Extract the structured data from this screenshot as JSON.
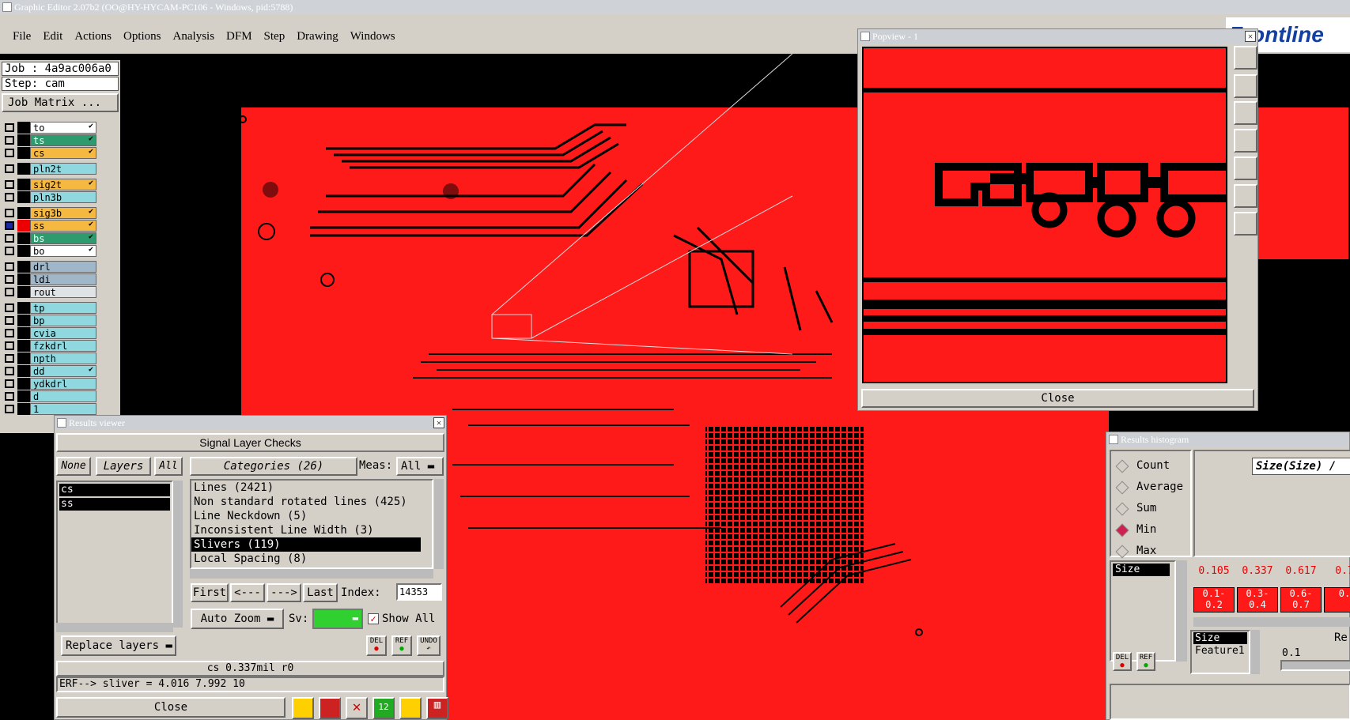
{
  "app": {
    "title": "Graphic Editor 2.07b2 (OO@HY-HYCAM-PC106 - Windows, pid:5788)",
    "brand": "Frontline"
  },
  "menu": [
    "File",
    "Edit",
    "Actions",
    "Options",
    "Analysis",
    "DFM",
    "Step",
    "Drawing",
    "Windows"
  ],
  "job": {
    "job_label": "Job : 4a9ac006a0",
    "step_label": "Step: cam",
    "matrix_button": "Job Matrix ..."
  },
  "layers": [
    {
      "name": "to",
      "color": "#ffffff",
      "tick": true
    },
    {
      "name": "ts",
      "color": "#2e9b6e",
      "tick": true
    },
    {
      "name": "cs",
      "color": "#f5b942",
      "tick": true
    },
    {
      "name": "pln2t",
      "color": "#8fd8e0",
      "tick": false
    },
    {
      "name": "sig2t",
      "color": "#f5b942",
      "tick": true
    },
    {
      "name": "pln3b",
      "color": "#8fd8e0",
      "tick": false
    },
    {
      "name": "sig3b",
      "color": "#f5b942",
      "tick": true
    },
    {
      "name": "ss",
      "color": "#f5b942",
      "tick": true,
      "active": true
    },
    {
      "name": "bs",
      "color": "#2e9b6e",
      "tick": true
    },
    {
      "name": "bo",
      "color": "#ffffff",
      "tick": true
    },
    {
      "name": "drl",
      "color": "#9fb7c8",
      "tick": false
    },
    {
      "name": "ldi",
      "color": "#9fb7c8",
      "tick": false
    },
    {
      "name": "rout",
      "color": "#dfe3e6",
      "tick": false
    },
    {
      "name": "tp",
      "color": "#8fd8e0",
      "tick": false
    },
    {
      "name": "bp",
      "color": "#8fd8e0",
      "tick": false
    },
    {
      "name": "cvia",
      "color": "#8fd8e0",
      "tick": false
    },
    {
      "name": "fzkdrl",
      "color": "#8fd8e0",
      "tick": false
    },
    {
      "name": "npth",
      "color": "#8fd8e0",
      "tick": false
    },
    {
      "name": "dd",
      "color": "#8fd8e0",
      "tick": true
    },
    {
      "name": "ydkdrl",
      "color": "#8fd8e0",
      "tick": false
    },
    {
      "name": "d",
      "color": "#8fd8e0",
      "tick": false
    },
    {
      "name": "1",
      "color": "#8fd8e0",
      "tick": false
    }
  ],
  "popview": {
    "title": "Popview - 1",
    "close": "Close"
  },
  "results_viewer": {
    "title": "Results viewer",
    "header": "Signal Layer Checks",
    "none_btn": "None",
    "layers_btn": "Layers",
    "all_btn": "All",
    "layer_items": [
      "cs",
      "ss"
    ],
    "categories_label": "Categories (26)",
    "meas_label": "Meas:",
    "meas_value": "All",
    "categories": [
      "Lines (2421)",
      "Non standard rotated lines (425)",
      "Line Neckdown (5)",
      "Inconsistent Line Width (3)",
      "Slivers (119)",
      "Local Spacing (8)"
    ],
    "selected_category": "Slivers (119)",
    "nav": {
      "first": "First",
      "prev": "<---",
      "next": "--->",
      "last": "Last",
      "index_label": "Index:",
      "index_value": "14353"
    },
    "auto_zoom": "Auto Zoom",
    "sv_label": "Sv:",
    "show_all": "Show All",
    "del": "DEL",
    "ref": "REF",
    "undo": "UNDO",
    "replace_layers": "Replace layers",
    "status": "cs 0.337mil  r0",
    "erf": "ERF--> sliver = 4.016 7.992 10",
    "close": "Close"
  },
  "histogram": {
    "title": "Results histogram",
    "options": [
      "Count",
      "Average",
      "Sum",
      "Min",
      "Max"
    ],
    "selected": "Min",
    "size_header": "Size(Size) / ",
    "list_item": "Size",
    "values": [
      "0.105",
      "0.337",
      "0.617",
      "0.7"
    ],
    "bins": [
      [
        "0.1-",
        "0.2"
      ],
      [
        "0.3-",
        "0.4"
      ],
      [
        "0.6-",
        "0.7"
      ],
      [
        "0.",
        ""
      ]
    ],
    "list2": [
      "Size",
      "Feature1"
    ],
    "re_label": "Re",
    "slider_value": "0.1",
    "del": "DEL",
    "ref": "REF"
  }
}
